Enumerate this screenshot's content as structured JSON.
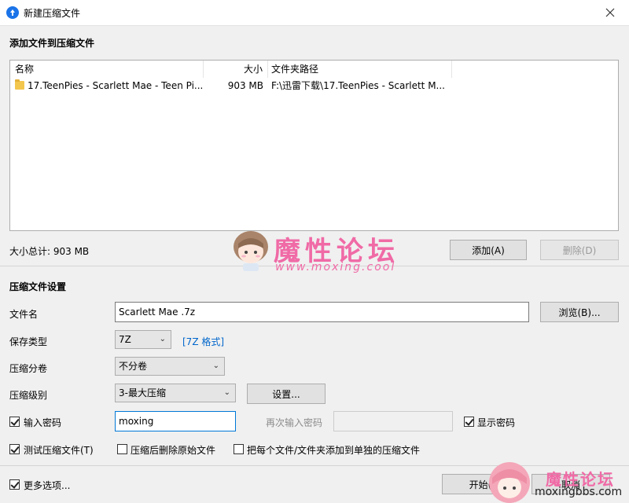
{
  "window": {
    "title": "新建压缩文件"
  },
  "add_section": {
    "title": "添加文件到压缩文件"
  },
  "list": {
    "columns": [
      "名称",
      "大小",
      "文件夹路径"
    ],
    "rows": [
      {
        "name": "17.TeenPies - Scarlett Mae - Teen Pi...",
        "size": "903 MB",
        "path": "F:\\迅雷下载\\17.TeenPies - Scarlett M..."
      }
    ]
  },
  "summary": {
    "total": "大小总计: 903 MB"
  },
  "buttons": {
    "add": "添加(A)",
    "delete": "删除(D)",
    "browse": "浏览(B)...",
    "settings": "设置...",
    "start": "开始(",
    "cancel": "取消"
  },
  "settings_section": {
    "title": "压缩文件设置"
  },
  "fields": {
    "filename_label": "文件名",
    "filename_value": "Scarlett Mae .7z",
    "save_type_label": "保存类型",
    "save_type_value": "7Z",
    "save_type_link": "[7Z 格式]",
    "split_label": "压缩分卷",
    "split_value": "不分卷",
    "level_label": "压缩级别",
    "level_value": "3-最大压缩",
    "password_label": "输入密码",
    "password_value": "moxing",
    "reenter_label": "再次输入密码",
    "show_password_label": "显示密码",
    "test_label": "测试压缩文件(T)",
    "delete_after_label": "压缩后删除原始文件",
    "separate_label": "把每个文件/文件夹添加到单独的压缩文件",
    "more_options_label": "更多选项..."
  },
  "checks": {
    "password": true,
    "show_password": true,
    "test": true,
    "delete_after": false,
    "separate": false,
    "more_options": true
  },
  "watermark": {
    "text": "魔性论坛",
    "url": "www.moxing.cool",
    "text2": "魔性论坛",
    "url2": "moxingbbs.com"
  },
  "colors": {
    "accent": "#0078d7",
    "link": "#0066cc",
    "watermark": "#f06aa6"
  }
}
